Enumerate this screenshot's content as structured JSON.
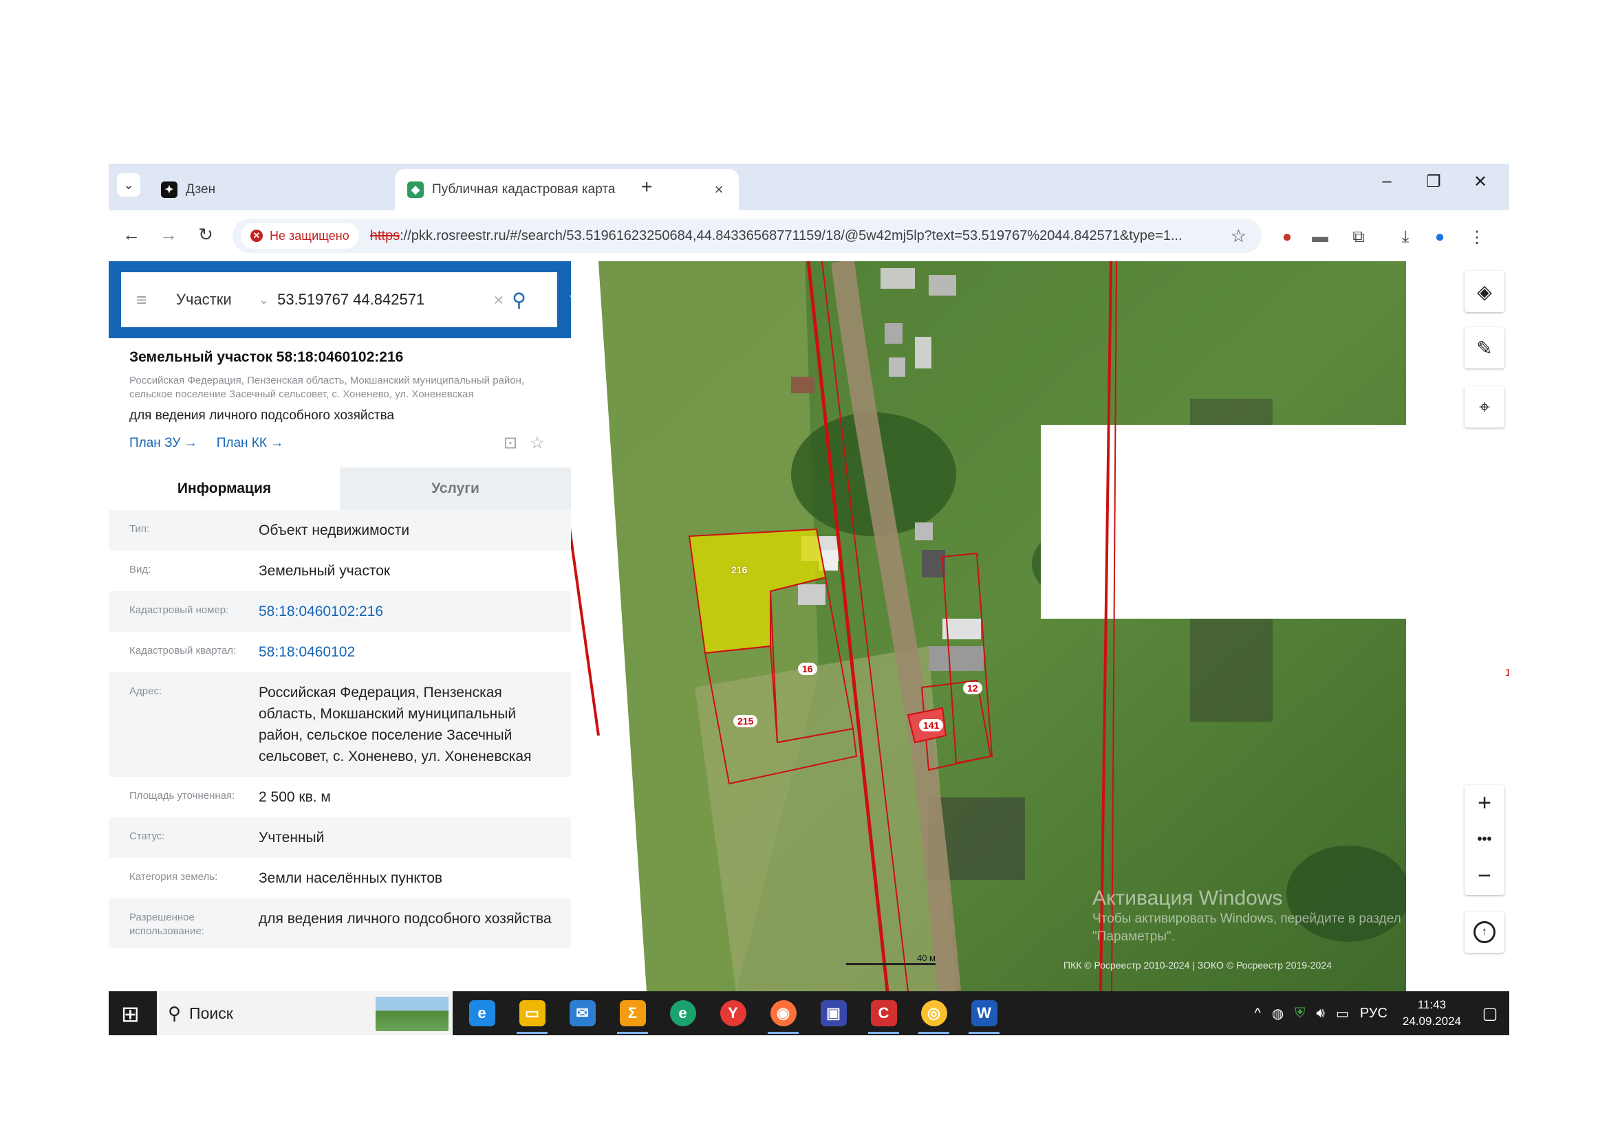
{
  "browser": {
    "tabs": [
      {
        "title": "Дзен",
        "favicon": "dzen-icon"
      },
      {
        "title": "Публичная кадастровая карта",
        "favicon": "rosreestr-icon"
      }
    ],
    "security_label": "Не защищено",
    "url_scheme": "https",
    "url_rest": "://pkk.rosreestr.ru/#/search/53.51961623250684,44.84336568771159/18/@5w42mj5lp?text=53.519767%2044.842571&type=1..."
  },
  "search": {
    "category": "Участки",
    "query": "53.519767 44.842571"
  },
  "object": {
    "title": "Земельный участок 58:18:0460102:216",
    "address_line": "Российская Федерация, Пензенская область, Мокшанский муниципальный район, сельское поселение Засечный сельсовет, с. Хоненево, ул. Хоненевская",
    "use": "для ведения личного подсобного хозяйства",
    "plan_zu": "План ЗУ →",
    "plan_kk": "План КК →"
  },
  "panel_tabs": {
    "info": "Информация",
    "services": "Услуги"
  },
  "info_rows": [
    {
      "key": "Тип:",
      "value": "Объект недвижимости"
    },
    {
      "key": "Вид:",
      "value": "Земельный участок"
    },
    {
      "key": "Кадастровый номер:",
      "value": "58:18:0460102:216"
    },
    {
      "key": "Кадастровый квартал:",
      "value": "58:18:0460102"
    },
    {
      "key": "Адрес:",
      "value": "Российская Федерация, Пензенская область, Мокшанский муниципальный район, сельское поселение Засечный сельсовет, с. Хоненево, ул. Хоненевская"
    },
    {
      "key": "Площадь уточненная:",
      "value": "2 500 кв. м"
    },
    {
      "key": "Статус:",
      "value": "Учтенный"
    },
    {
      "key": "Категория земель:",
      "value": "Земли населённых пунктов"
    },
    {
      "key": "Разрешенное использование:",
      "value": "для ведения личного подсобного хозяйства"
    }
  ],
  "map": {
    "parcel_labels": {
      "p216": "216",
      "p16": "16",
      "p215": "215",
      "p12": "12",
      "p141": "141"
    },
    "scale_label": "40 м",
    "edge_label": "1",
    "watermark_title": "Активация Windows",
    "watermark_text": "Чтобы активировать Windows, перейдите в раздел \"Параметры\".",
    "attribution": "ПКК © Росреестр 2010-2024 | ЗОКО © Росреестр 2019-2024",
    "colors": {
      "selected_fill": "#d8d800",
      "parcel_border": "#cc1010"
    }
  },
  "taskbar": {
    "search_placeholder": "Поиск",
    "language": "РУС",
    "time": "11:43",
    "date": "24.09.2024"
  }
}
